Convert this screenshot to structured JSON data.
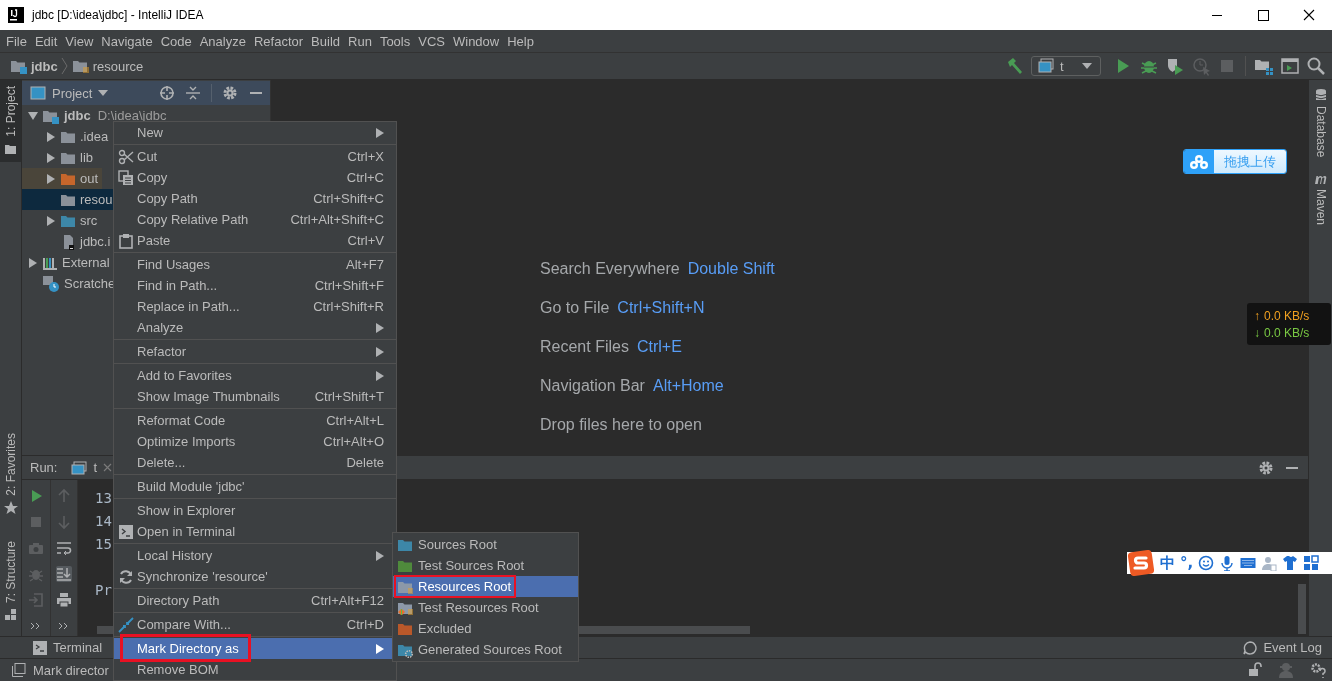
{
  "window": {
    "title": "jdbc [D:\\idea\\jdbc] - IntelliJ IDEA"
  },
  "menu_bar": [
    "File",
    "Edit",
    "View",
    "Navigate",
    "Code",
    "Analyze",
    "Refactor",
    "Build",
    "Run",
    "Tools",
    "VCS",
    "Window",
    "Help"
  ],
  "breadcrumbs": [
    {
      "label": "jdbc",
      "kind": "module"
    },
    {
      "label": "resource",
      "kind": "resources"
    }
  ],
  "run_config": {
    "label": "t"
  },
  "left_stripe": [
    {
      "label": "1: Project",
      "selected": true
    },
    {
      "label": "2: Favorites",
      "selected": false
    },
    {
      "label": "7: Structure",
      "selected": false
    }
  ],
  "project_panel": {
    "title": "Project",
    "tree": [
      {
        "label": "jdbc",
        "path": "D:\\idea\\jdbc",
        "kind": "module",
        "expanded": true,
        "selected": false,
        "children": [
          {
            "label": ".idea",
            "kind": "folder",
            "expanded": false,
            "selected": false
          },
          {
            "label": "lib",
            "kind": "folder",
            "expanded": false,
            "selected": false
          },
          {
            "label": "out",
            "kind": "excluded",
            "expanded": false,
            "selected": false
          },
          {
            "label": "resou",
            "kind": "folder",
            "selected": true
          },
          {
            "label": "src",
            "kind": "source",
            "expanded": false,
            "selected": false
          },
          {
            "label": "jdbc.i",
            "kind": "file",
            "selected": false
          }
        ]
      },
      {
        "label": "External",
        "kind": "libraries",
        "expanded": false,
        "selected": false
      },
      {
        "label": "Scratche",
        "kind": "scratches",
        "selected": false
      }
    ]
  },
  "editor_hints": [
    {
      "label": "Search Everywhere",
      "shortcut": "Double Shift"
    },
    {
      "label": "Go to File",
      "shortcut": "Ctrl+Shift+N"
    },
    {
      "label": "Recent Files",
      "shortcut": "Ctrl+E"
    },
    {
      "label": "Navigation Bar",
      "shortcut": "Alt+Home"
    },
    {
      "label": "Drop files here to open"
    }
  ],
  "right_stripe": [
    {
      "label": "Database",
      "kind": "database"
    },
    {
      "label": "Maven",
      "kind": "maven"
    }
  ],
  "run_panel": {
    "title": "Run:",
    "tab": "t",
    "line_blocks": [
      [
        "13",
        "14",
        "15"
      ],
      [
        "Pr"
      ]
    ]
  },
  "context_menu": {
    "groups": [
      [
        {
          "label": "New",
          "submenu": true,
          "selected": false,
          "marked": false
        }
      ],
      [
        {
          "label": "Cut",
          "shortcut": "Ctrl+X",
          "submenu": false,
          "selected": false,
          "marked": false
        },
        {
          "label": "Copy",
          "shortcut": "Ctrl+C",
          "submenu": false,
          "selected": false,
          "marked": false
        },
        {
          "label": "Copy Path",
          "shortcut": "Ctrl+Shift+C",
          "submenu": false,
          "selected": false,
          "marked": false
        },
        {
          "label": "Copy Relative Path",
          "shortcut": "Ctrl+Alt+Shift+C",
          "submenu": false,
          "selected": false,
          "marked": false
        },
        {
          "label": "Paste",
          "shortcut": "Ctrl+V",
          "submenu": false,
          "selected": false,
          "marked": false
        }
      ],
      [
        {
          "label": "Find Usages",
          "shortcut": "Alt+F7",
          "submenu": false,
          "selected": false,
          "marked": false
        },
        {
          "label": "Find in Path...",
          "shortcut": "Ctrl+Shift+F",
          "submenu": false,
          "selected": false,
          "marked": false
        },
        {
          "label": "Replace in Path...",
          "shortcut": "Ctrl+Shift+R",
          "submenu": false,
          "selected": false,
          "marked": false
        },
        {
          "label": "Analyze",
          "submenu": true,
          "selected": false,
          "marked": false
        }
      ],
      [
        {
          "label": "Refactor",
          "submenu": true,
          "selected": false,
          "marked": false
        }
      ],
      [
        {
          "label": "Add to Favorites",
          "submenu": true,
          "selected": false,
          "marked": false
        },
        {
          "label": "Show Image Thumbnails",
          "shortcut": "Ctrl+Shift+T",
          "submenu": false,
          "selected": false,
          "marked": false
        }
      ],
      [
        {
          "label": "Reformat Code",
          "shortcut": "Ctrl+Alt+L",
          "submenu": false,
          "selected": false,
          "marked": false
        },
        {
          "label": "Optimize Imports",
          "shortcut": "Ctrl+Alt+O",
          "submenu": false,
          "selected": false,
          "marked": false
        },
        {
          "label": "Delete...",
          "shortcut": "Delete",
          "submenu": false,
          "selected": false,
          "marked": false
        }
      ],
      [
        {
          "label": "Build Module 'jdbc'",
          "submenu": false,
          "selected": false,
          "marked": false
        }
      ],
      [
        {
          "label": "Show in Explorer",
          "submenu": false,
          "selected": false,
          "marked": false
        },
        {
          "label": "Open in Terminal",
          "submenu": false,
          "selected": false,
          "marked": false
        }
      ],
      [
        {
          "label": "Local History",
          "submenu": true,
          "selected": false,
          "marked": false
        },
        {
          "label": "Synchronize 'resource'",
          "submenu": false,
          "selected": false,
          "marked": false
        }
      ],
      [
        {
          "label": "Directory Path",
          "shortcut": "Ctrl+Alt+F12",
          "submenu": false,
          "selected": false,
          "marked": false
        }
      ],
      [
        {
          "label": "Compare With...",
          "shortcut": "Ctrl+D",
          "submenu": false,
          "selected": false,
          "marked": false
        }
      ],
      [
        {
          "label": "Mark Directory as",
          "submenu": true,
          "selected": true,
          "marked": true
        },
        {
          "label": "Remove BOM",
          "submenu": false,
          "selected": false,
          "marked": false
        }
      ]
    ]
  },
  "submenu": {
    "items": [
      {
        "label": "Sources Root",
        "color": "#3d87a8",
        "selected": false,
        "marked": false
      },
      {
        "label": "Test Sources Root",
        "color": "#4f8a3c",
        "selected": false,
        "marked": false
      },
      {
        "label": "Resources Root",
        "color": "#8c98a8",
        "selected": true,
        "marked": true
      },
      {
        "label": "Test Resources Root",
        "color": "#8c98a8",
        "selected": false,
        "marked": false
      },
      {
        "label": "Excluded",
        "color": "#b9582a",
        "selected": false,
        "marked": false
      },
      {
        "label": "Generated Sources Root",
        "color": "#3d87a8",
        "selected": false,
        "marked": false
      }
    ]
  },
  "bottom_tabs": {
    "left": "Terminal",
    "right": "Event Log"
  },
  "status_bar": {
    "message": "Mark director"
  },
  "upload_widget": {
    "label": "拖拽上传"
  },
  "net_speed": [
    {
      "arrow": "↑",
      "value": "0.0 KB/s",
      "kind": "up"
    },
    {
      "arrow": "↓",
      "value": "0.0 KB/s",
      "kind": "down"
    }
  ],
  "ime_bar": {
    "texts": [
      "中",
      "°,"
    ]
  }
}
